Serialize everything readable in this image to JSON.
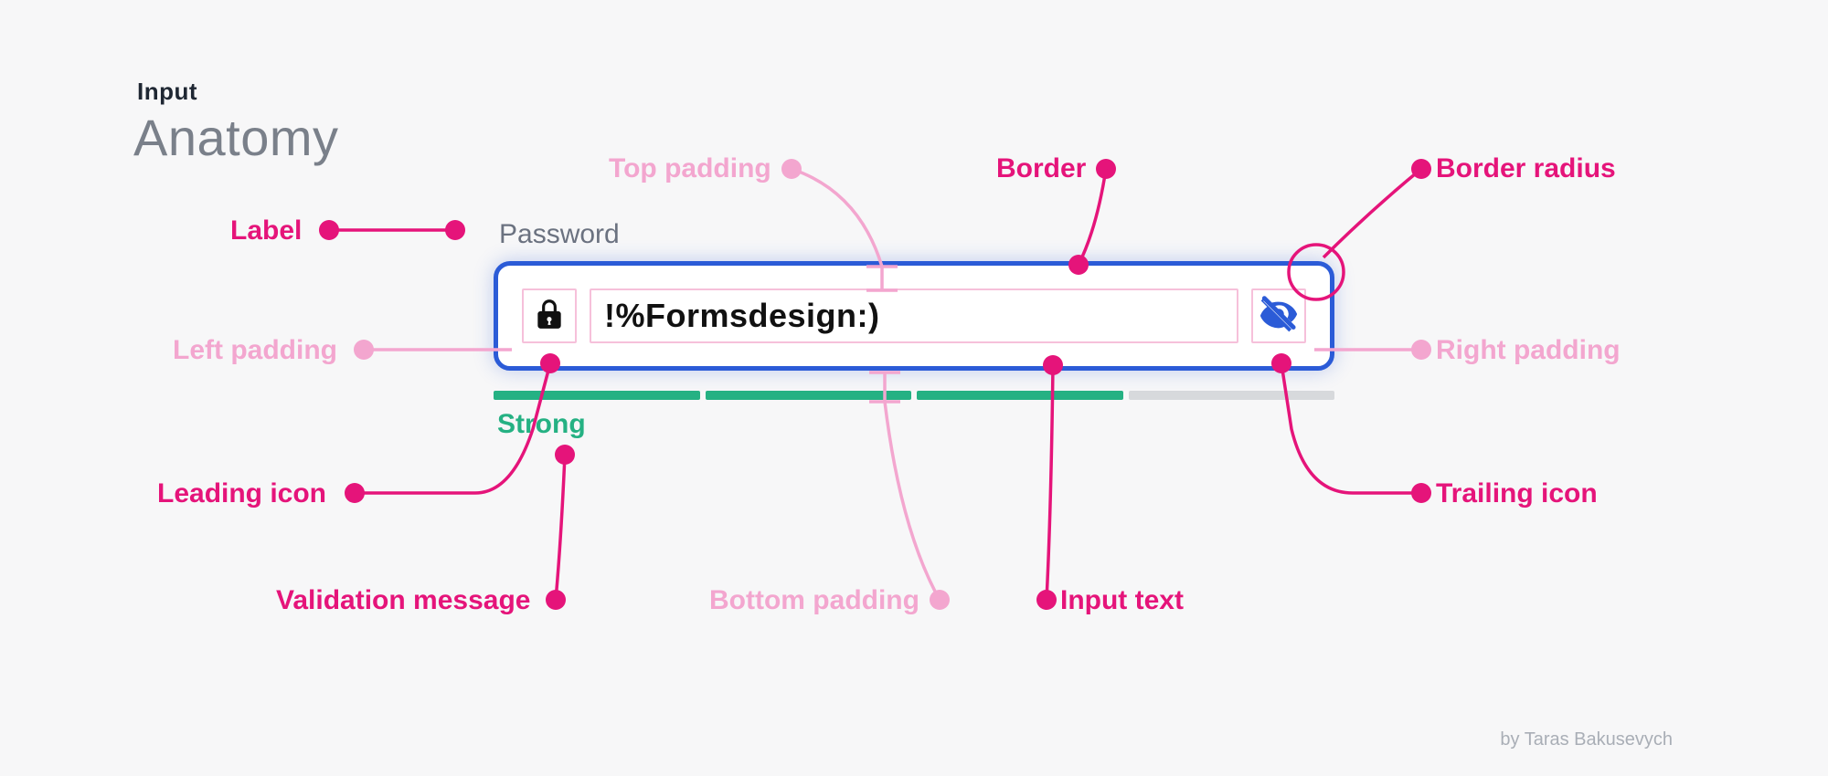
{
  "header": {
    "eyebrow": "Input",
    "title": "Anatomy"
  },
  "input": {
    "label": "Password",
    "value": "!%Formsdesign:)",
    "validation_message": "Strong",
    "strength_segments": 4,
    "strength_active": 3,
    "leading_icon_name": "lock-icon",
    "trailing_icon_name": "eye-off-icon"
  },
  "callouts": {
    "label": "Label",
    "left_padding": "Left padding",
    "leading_icon": "Leading icon",
    "validation_message": "Validation message",
    "top_padding": "Top padding",
    "bottom_padding": "Bottom padding",
    "border": "Border",
    "border_radius": "Border radius",
    "right_padding": "Right padding",
    "trailing_icon": "Trailing icon",
    "input_text": "Input text"
  },
  "credit": "by Taras Bakusevych",
  "colors": {
    "callout_bold": "#e5147a",
    "callout_light": "#f3a6cf",
    "border": "#2b5bd7",
    "success": "#25b183",
    "bg": "#f7f7f8"
  }
}
